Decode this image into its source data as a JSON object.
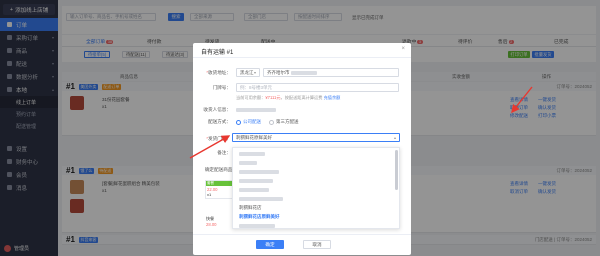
{
  "sidebar": {
    "add_button": "添加线上店铺",
    "items": [
      {
        "label": "订单",
        "active": true
      },
      {
        "label": "采购订单"
      },
      {
        "label": "商品"
      },
      {
        "label": "配送"
      },
      {
        "label": "数据分析"
      },
      {
        "label": "本地",
        "expanded": true
      }
    ],
    "sub_items": [
      "线上订单",
      "预约订单",
      "配送管理"
    ],
    "bottom_items": [
      "设置",
      "财务中心",
      "会员",
      "消息"
    ],
    "user_name": "管理员"
  },
  "filter": {
    "search_placeholder": "输入订单号、商品名、手机号或姓名",
    "search_button": "搜索",
    "select1": "全部来源",
    "select2": "全部门店",
    "select3": "按配送时间排序",
    "checkbox_label": "显示已完成订单"
  },
  "tabs": [
    {
      "label": "全部订单",
      "count": "38",
      "active": true
    },
    {
      "label": "待付款",
      "count": ""
    },
    {
      "label": "待发货",
      "count": ""
    },
    {
      "label": "配送中",
      "count": ""
    },
    {
      "label": "退款中",
      "count": "3"
    },
    {
      "label": "待评价",
      "count": ""
    },
    {
      "label": "售后",
      "count": "2"
    },
    {
      "label": "已完成",
      "count": ""
    }
  ],
  "subtabs": [
    "待接单(5)",
    "待配送(11)",
    "待送达(3)"
  ],
  "green_buttons": [
    "打印订单",
    "批量发货"
  ],
  "table_headers": [
    "商品信息",
    "收货人",
    "配送方式",
    "实收金额",
    "操作"
  ],
  "orders": [
    {
      "num": "#1",
      "tag": "美团外卖",
      "tag2": "配送订单",
      "right": "订单号：2024052",
      "line1": "31份花园套餐",
      "line2": "x1",
      "actions": [
        "查看详情",
        "一键发货",
        "取消订单",
        "确认发货",
        "修改配送",
        "打印小票"
      ]
    },
    {
      "num": "#1",
      "tag": "饿了么",
      "tag2": "待配送",
      "right": "订单号：2024052",
      "line1": "[套餐]鲜花蛋糕组合 精美包装",
      "line2": "x1",
      "actions": [
        "查看详情",
        "一键发货",
        "取消订单",
        "确认发货"
      ]
    },
    {
      "num": "#1",
      "tag": "抖音来客",
      "tag2": "",
      "right": "门店配送 | 订单号：2024052",
      "line1": "",
      "line2": "",
      "actions": []
    }
  ],
  "modal": {
    "title": "自有运输 #1",
    "close": "×",
    "fields": {
      "address_label": "收货地址：",
      "region": "黑龙江",
      "address_value": "齐齐哈尔市",
      "doorplate_label": "门牌号：",
      "doorplate_placeholder": "例：8号楼3单元",
      "note": "当前可用余额：",
      "note_amount": "¥7111元",
      "note_tail": "，按配送距离计算运费",
      "note_link": "充值余额",
      "receiver_label": "收货人信息：",
      "delivery_label": "配送方式：",
      "radio1": "公司配送",
      "radio2": "第三方配送",
      "store_label": "发货门店：",
      "store_value": "刺猬鲜花原鲜美好",
      "remark_label": "备注：",
      "check_label": "确定配送商品：",
      "card1_badge": "套餐",
      "card1_price": "22.00",
      "card1_sub": "x1",
      "card2_name": "快餐",
      "card2_price": "28.00"
    },
    "dropdown_options": [
      {
        "label": "",
        "selected": false
      },
      {
        "label": "",
        "selected": false
      },
      {
        "label": "",
        "selected": false
      },
      {
        "label": "",
        "selected": false
      },
      {
        "label": "",
        "selected": false
      },
      {
        "label": "刺猬鲜花店",
        "selected": false
      },
      {
        "label": "刺猬鲜花店原鲜美好",
        "selected": true
      },
      {
        "label": "",
        "selected": false
      },
      {
        "label": "",
        "selected": false
      }
    ],
    "confirm": "确定",
    "cancel": "取消"
  },
  "colors": {
    "accent": "#3b7ff6",
    "sidebar": "#2f3447",
    "danger": "#f56c6c",
    "arrow": "#e8372f"
  }
}
